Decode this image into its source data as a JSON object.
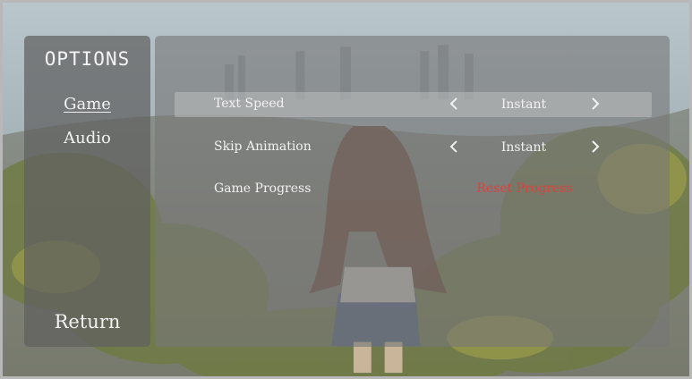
{
  "menu": {
    "title": "OPTIONS",
    "items": [
      {
        "label": "Game",
        "active": true
      },
      {
        "label": "Audio",
        "active": false
      }
    ],
    "return_label": "Return"
  },
  "settings": [
    {
      "label": "Text Speed",
      "value": "Instant"
    },
    {
      "label": "Skip Animation",
      "value": "Instant"
    },
    {
      "label": "Game Progress",
      "action": "Reset Progress"
    }
  ],
  "colors": {
    "panel": "#5f5f5f",
    "text": "#f2f2f2",
    "danger": "#d9443d"
  }
}
